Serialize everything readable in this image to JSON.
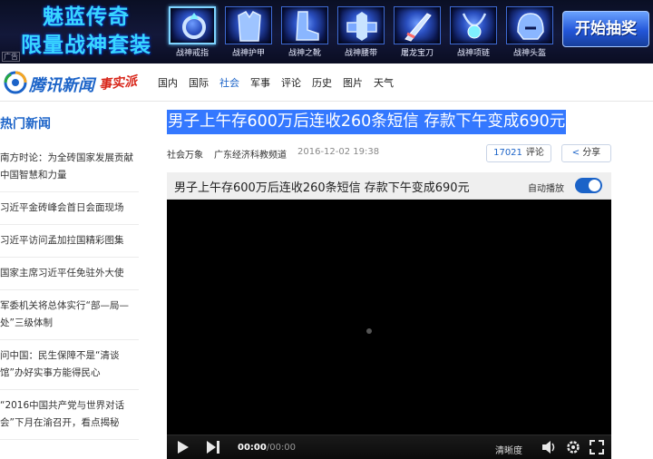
{
  "banner": {
    "promo_line1": "魅蓝传奇",
    "promo_line2": "限量战神套装",
    "ad_tag": "广告",
    "items": [
      {
        "label": "战神戒指",
        "icon": "ring-icon",
        "selected": true
      },
      {
        "label": "战神护甲",
        "icon": "armor-icon",
        "selected": false
      },
      {
        "label": "战神之靴",
        "icon": "boots-icon",
        "selected": false
      },
      {
        "label": "战神腰带",
        "icon": "belt-icon",
        "selected": false
      },
      {
        "label": "屠龙宝刀",
        "icon": "sword-icon",
        "selected": false
      },
      {
        "label": "战神项链",
        "icon": "necklace-icon",
        "selected": false
      },
      {
        "label": "战神头盔",
        "icon": "helmet-icon",
        "selected": false
      }
    ],
    "start_button": "开始抽奖"
  },
  "site": {
    "brand": "腾讯新闻",
    "sub_brand": "事实派",
    "nav": [
      "国内",
      "国际",
      "社会",
      "军事",
      "评论",
      "历史",
      "图片",
      "天气"
    ],
    "active_nav": "社会"
  },
  "sidebar": {
    "title": "热门新闻",
    "items": [
      "南方时论：为全砖国家发展贡献中国智慧和力量",
      "习近平金砖峰会首日会面现场",
      "习近平访问孟加拉国精彩图集",
      "国家主席习近平任免驻外大使",
      "军委机关将总体实行“部—局—处”三级体制",
      "问中国：民生保障不是“清谈馆”办好实事方能得民心",
      "“2016中国共产党与世界对话会”下月在渝召开，看点揭秘"
    ]
  },
  "article": {
    "headline": "男子上午存600万后连收260条短信 存款下午变成690元",
    "category": "社会万象",
    "source": "广东经济科教频道",
    "date": "2016-12-02 19:38",
    "comment_count": "17021",
    "comment_label": "评论",
    "share_label": "分享"
  },
  "player": {
    "title": "男子上午存600万后连收260条短信 存款下午变成690元",
    "autoplay_label": "自动播放",
    "autoplay_on": true,
    "time_current": "00:00",
    "time_total": "/00:00",
    "quality_label": "清晰度"
  },
  "colors": {
    "accent": "#1b63c8",
    "headline_highlight": "#3478ff",
    "banner_bg": "#0a0f24"
  }
}
